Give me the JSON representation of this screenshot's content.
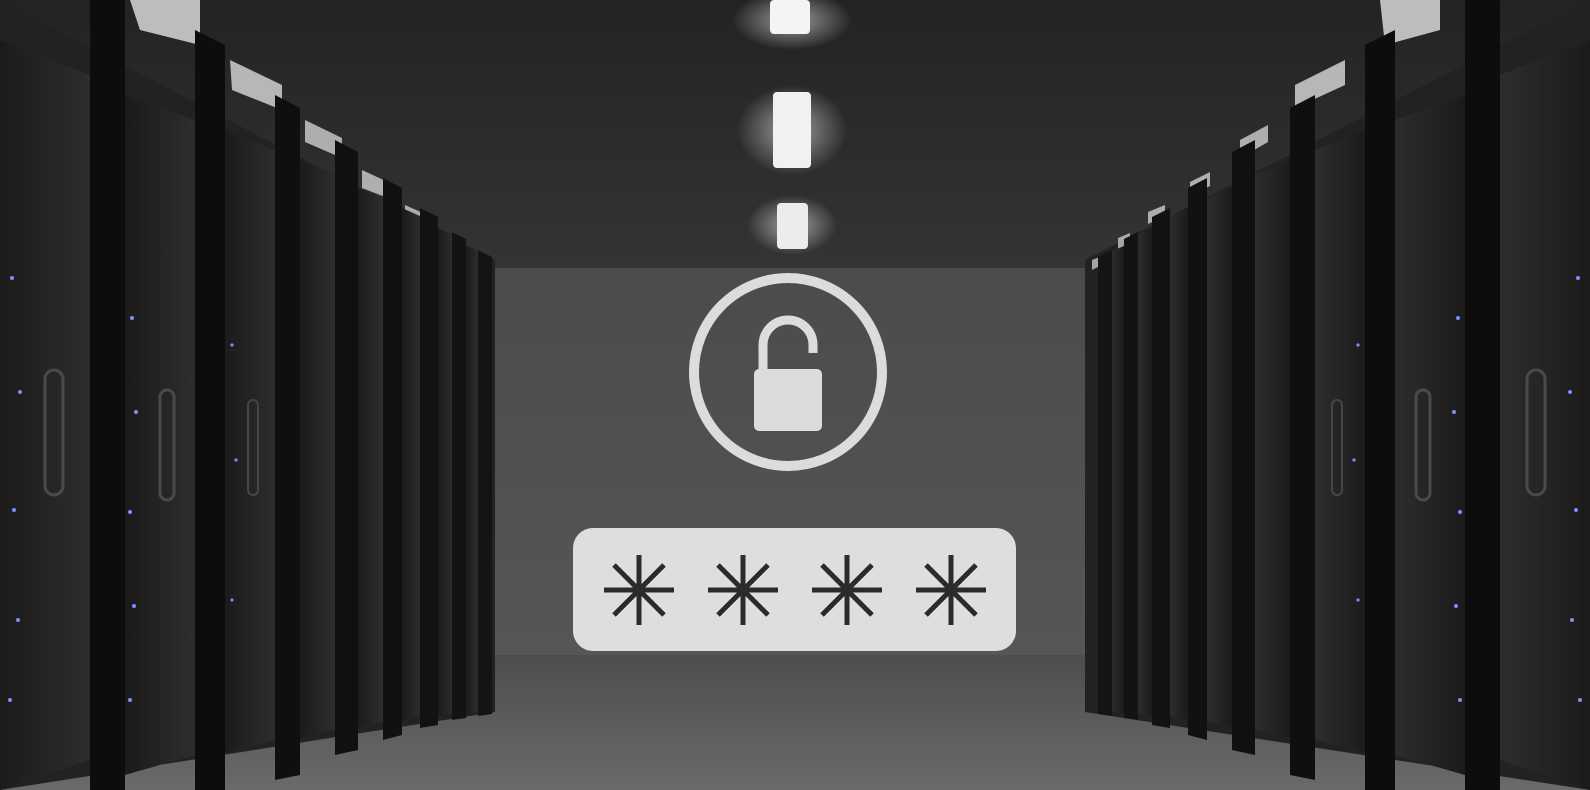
{
  "scene": {
    "type": "photo-illustration",
    "subject": "server-room-corridor",
    "palette": {
      "background": "#3a3a3a",
      "ceiling": "#2c2c2c",
      "wall": "#4a4a4a",
      "floor": "#555555",
      "rack": "#141414",
      "glass": "#2a2a2a",
      "light": "#f2f2f2",
      "led": "#6a7bff",
      "overlay": "#dcdcdc"
    }
  },
  "lock": {
    "icon": "unlocked-padlock-icon",
    "state": "unlocked"
  },
  "password": {
    "icon": "asterisk-icon",
    "masked_count": 4,
    "value": "****"
  }
}
